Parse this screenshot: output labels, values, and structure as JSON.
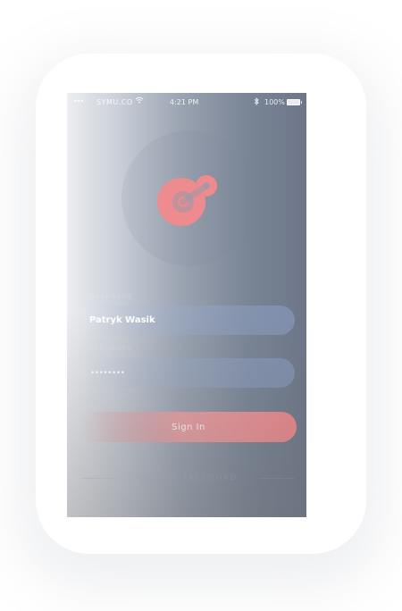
{
  "status_bar": {
    "signal": "•••",
    "carrier": "SYMU.CO",
    "time": "4:21 PM",
    "battery": "100%"
  },
  "colors": {
    "accent": "#ef8a8d",
    "logo": "#ee8b8e"
  },
  "login": {
    "username_label": "USERNAME",
    "username_value": "Patryk Wasik",
    "password_label": "PASSWORD",
    "password_mask": "••••••••",
    "signin_label": "Sign In",
    "forgot_label": "FORGOT PASSWORD"
  },
  "icons": [
    "wifi-icon",
    "bluetooth-icon",
    "battery-icon",
    "app-logo-icon"
  ]
}
